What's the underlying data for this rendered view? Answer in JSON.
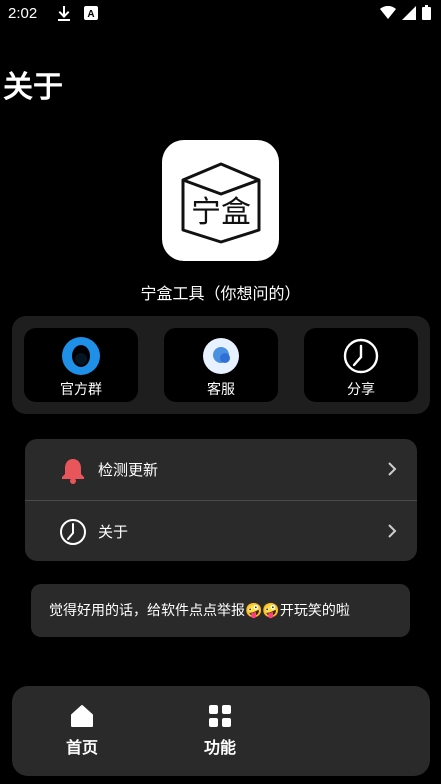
{
  "status_bar": {
    "time": "2:02",
    "icons": [
      "download-icon",
      "text-notification-icon",
      "wifi-icon",
      "signal-icon",
      "battery-icon"
    ]
  },
  "page": {
    "title": "关于",
    "app_logo_text": "宁盒",
    "app_name": "宁盒工具（你想问的）"
  },
  "quick_actions": [
    {
      "label": "官方群",
      "icon": "qq-penguin-icon"
    },
    {
      "label": "客服",
      "icon": "customer-service-icon"
    },
    {
      "label": "分享",
      "icon": "clock-icon"
    }
  ],
  "settings_list": [
    {
      "label": "检测更新",
      "icon": "bell-icon"
    },
    {
      "label": "关于",
      "icon": "clock-icon"
    }
  ],
  "message": {
    "text": "觉得好用的话，给软件点点举报🤪🤪开玩笑的啦"
  },
  "bottom_nav": [
    {
      "label": "首页",
      "icon": "home-icon"
    },
    {
      "label": "功能",
      "icon": "grid-icon"
    }
  ],
  "colors": {
    "background": "#000000",
    "panel": "#1e1e1e",
    "card": "#2a2a2a",
    "bell": "#e8555a",
    "qq_blue": "#1e90e8"
  }
}
